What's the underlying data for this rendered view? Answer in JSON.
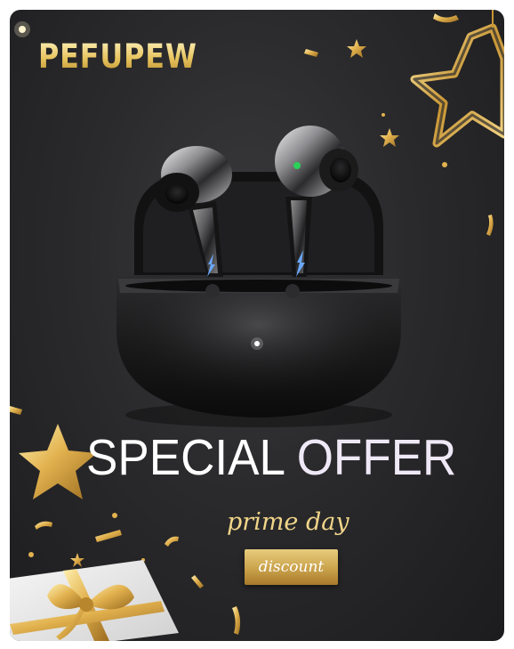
{
  "brand": {
    "name": "PEFUPEW"
  },
  "promo": {
    "headline_part1": "SPECIAL",
    "headline_part2": "OFFER",
    "event_line": "prime day",
    "sub_badge": "discount"
  },
  "colors": {
    "background": "#2a2a2c",
    "gold": "#d4a84b",
    "headline": "#ffffff"
  },
  "icons": [
    "star-icon",
    "gift-box-icon",
    "confetti-icon"
  ]
}
